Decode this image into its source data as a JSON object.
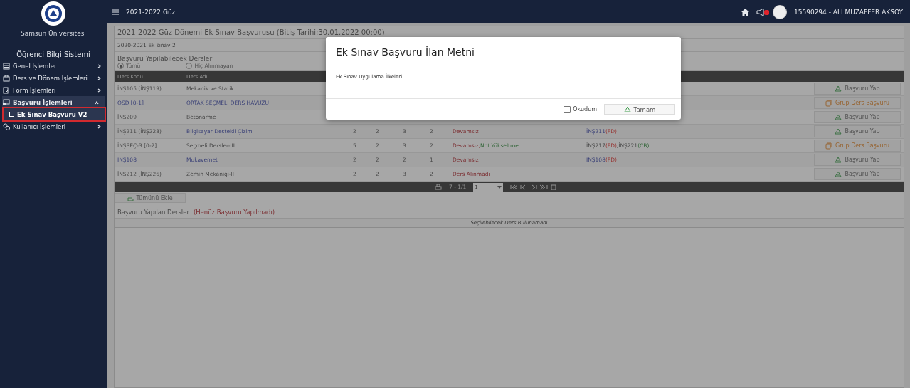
{
  "sidebar": {
    "university": "Samsun Üniversitesi",
    "system": "Öğrenci Bilgi Sistemi",
    "items": [
      {
        "label": "Genel İşlemler",
        "expanded": false
      },
      {
        "label": "Ders ve Dönem İşlemleri",
        "expanded": false
      },
      {
        "label": "Form İşlemleri",
        "expanded": false
      },
      {
        "label": "Başvuru İşlemleri",
        "expanded": true,
        "children": [
          {
            "label": "Ek Sınav Başvuru V2",
            "selected": true
          }
        ]
      },
      {
        "label": "Kullanıcı İşlemleri",
        "expanded": false
      }
    ]
  },
  "topbar": {
    "term": "2021-2022 Güz",
    "user": "15590294 - ALİ MUZAFFER AKSOY"
  },
  "panel": {
    "title": "2021-2022 Güz Dönemi Ek Sınav Başvurusu (Bitiş Tarihi:30.01.2022 00:00)",
    "subtitle": "2020-2021 Ek sınav 2",
    "section_title": "Başvuru Yapılabilecek Dersler",
    "filters": [
      {
        "label": "Tümü",
        "selected": true
      },
      {
        "label": "Hiç Alınmayan",
        "selected": false
      }
    ],
    "columns": [
      "Ders Kodu",
      "Ders Adı"
    ],
    "rows": [
      {
        "code": "İNŞ105 (İNŞ119)",
        "code_link": false,
        "name": "Mekanik ve Statik",
        "name_link": false,
        "numbers": [],
        "status": [],
        "prereq": [],
        "action": {
          "kind": "apply",
          "label": "Başvuru Yap"
        }
      },
      {
        "code": "OSD [0-1]",
        "code_link": true,
        "name": "ORTAK SEÇMELİ DERS HAVUZU",
        "name_link": true,
        "numbers": [],
        "status": [],
        "prereq": [],
        "action": {
          "kind": "group",
          "label": "Grup Ders Başvuru"
        }
      },
      {
        "code": "İNŞ209",
        "code_link": false,
        "name": "Betonarme",
        "name_link": false,
        "numbers": [],
        "status": [],
        "prereq": [],
        "action": {
          "kind": "apply",
          "label": "Başvuru Yap"
        }
      },
      {
        "code": "İNŞ211 (İNŞ223)",
        "code_link": false,
        "name": "Bilgisayar Destekli Çizim",
        "name_link": true,
        "numbers": [
          "2",
          "2",
          "3",
          "2"
        ],
        "status": [
          {
            "text": "Devamsız",
            "kind": "bad"
          }
        ],
        "prereq": [
          {
            "text": "İNŞ211",
            "kind": "code"
          },
          {
            "text": "(FD)",
            "kind": "fd"
          }
        ],
        "action": {
          "kind": "apply",
          "label": "Başvuru Yap"
        }
      },
      {
        "code": "İNŞSEÇ-3 [0-2]",
        "code_link": false,
        "name": "Seçmeli Dersler-III",
        "name_link": false,
        "numbers": [
          "5",
          "2",
          "3",
          "2"
        ],
        "status": [
          {
            "text": "Devamsız,",
            "kind": "bad"
          },
          {
            "text": "Not Yükseltme",
            "kind": "good"
          }
        ],
        "prereq": [
          {
            "text": "İNŞ217",
            "kind": "plain"
          },
          {
            "text": "(FD)",
            "kind": "fd"
          },
          {
            "text": ",İNŞ221",
            "kind": "plain"
          },
          {
            "text": "(CB)",
            "kind": "cb"
          }
        ],
        "action": {
          "kind": "group",
          "label": "Grup Ders Başvuru"
        }
      },
      {
        "code": "İNŞ108",
        "code_link": true,
        "name": "Mukavemet",
        "name_link": true,
        "numbers": [
          "2",
          "2",
          "2",
          "1"
        ],
        "status": [
          {
            "text": "Devamsız",
            "kind": "bad"
          }
        ],
        "prereq": [
          {
            "text": "İNŞ108",
            "kind": "code"
          },
          {
            "text": "(FD)",
            "kind": "fd"
          }
        ],
        "action": {
          "kind": "apply",
          "label": "Başvuru Yap"
        }
      },
      {
        "code": "İNŞ212 (İNŞ226)",
        "code_link": false,
        "name": "Zemin Mekaniği-II",
        "name_link": false,
        "numbers": [
          "2",
          "2",
          "3",
          "2"
        ],
        "status": [
          {
            "text": "Ders Alınmadı",
            "kind": "bad"
          }
        ],
        "prereq": [],
        "action": {
          "kind": "apply",
          "label": "Başvuru Yap"
        }
      }
    ],
    "pager": {
      "info": "7 - 1/1",
      "page": "1"
    },
    "add_all": "Tümünü Ekle",
    "applied_title": "Başvuru Yapılan Dersler",
    "applied_note": "(Henüz Başvuru Yapılmadı)",
    "empty": "Seçilebilecek Ders Bulunamadı"
  },
  "modal": {
    "title": "Ek Sınav Başvuru İlan Metni",
    "body": "Ek Sınav Uygulama İlkeleri",
    "checkbox": {
      "label": "Okudum",
      "checked": false
    },
    "ok": "Tamam"
  }
}
